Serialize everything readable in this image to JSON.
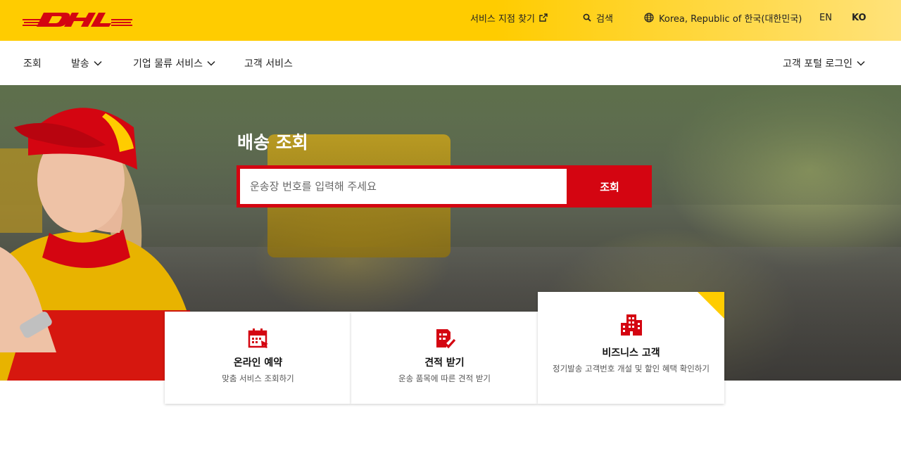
{
  "brand": {
    "name": "DHL",
    "color": "#d40511",
    "yellow": "#ffcc00"
  },
  "topnav": {
    "store_finder": "서비스 지점 찾기",
    "search": "검색",
    "region": "Korea, Republic of 한국(대한민국)",
    "lang_en": "EN",
    "lang_ko": "KO"
  },
  "mainnav": {
    "items": [
      {
        "label": "조회"
      },
      {
        "label": "발송"
      },
      {
        "label": "기업 물류 서비스"
      },
      {
        "label": "고객 서비스"
      }
    ],
    "portal": "고객 포털 로그인"
  },
  "hero": {
    "title": "배송 조회",
    "search_placeholder": "운송장 번호를 입력해 주세요",
    "search_button": "조회"
  },
  "cards": [
    {
      "title": "온라인 예약",
      "subtitle": "맞춤 서비스 조회하기",
      "icon": "calendar-icon"
    },
    {
      "title": "견적 받기",
      "subtitle": "운송 품목에 따른 견적 받기",
      "icon": "quote-document-icon"
    },
    {
      "title": "비즈니스 고객",
      "subtitle": "정기발송 고객번호 개설 및 할인 혜택 확인하기",
      "icon": "building-icon"
    }
  ]
}
